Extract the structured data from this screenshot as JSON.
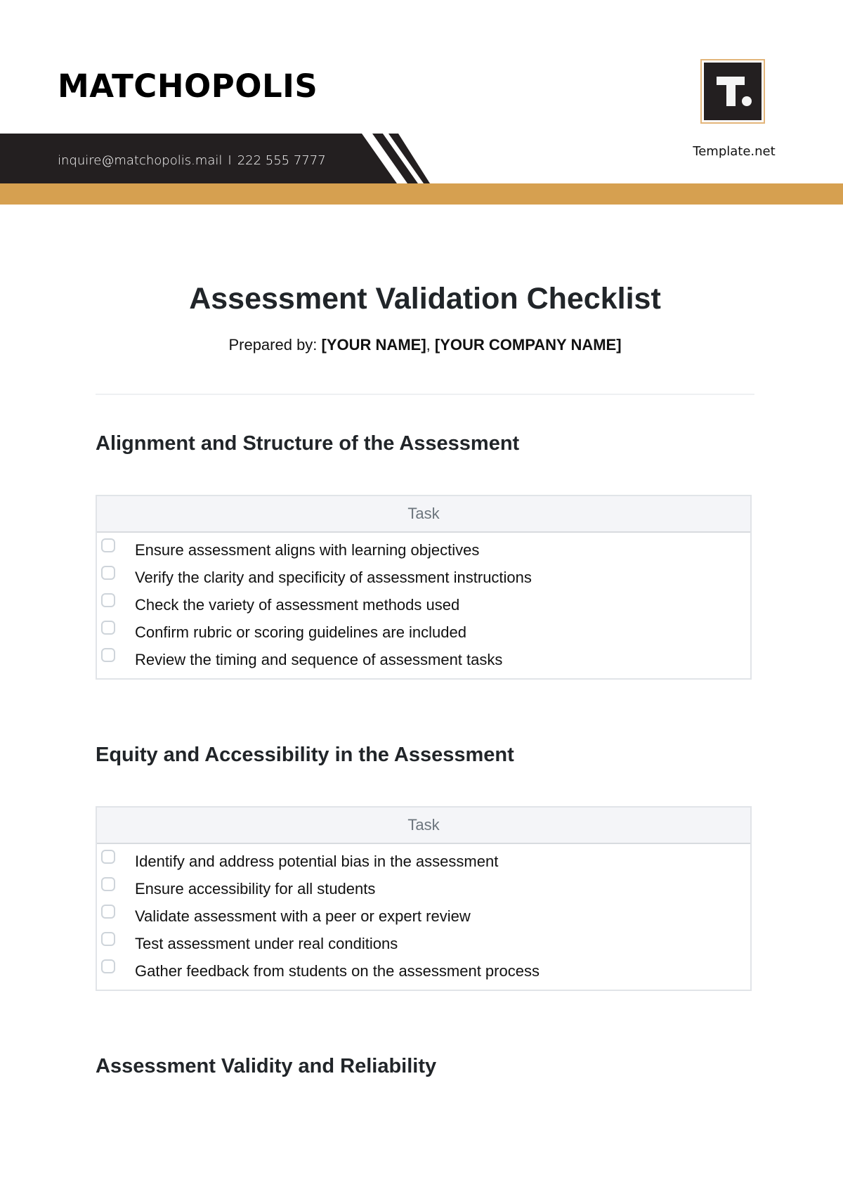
{
  "header": {
    "brand": "MATCHOPOLIS",
    "email": "inquire@matchopolis.mail",
    "separator": "I",
    "phone": "222 555 7777",
    "logo_icon": "template-net-logo-icon",
    "logo_caption": "Template.net",
    "colors": {
      "dark": "#231F20",
      "gold": "#D6A050",
      "logo_border": "#E3B57A"
    }
  },
  "document": {
    "title": "Assessment Validation Checklist",
    "prepared_label": "Prepared by:",
    "prepared_name": "[YOUR NAME]",
    "prepared_comma": ",",
    "prepared_company": "[YOUR COMPANY NAME]"
  },
  "sections": [
    {
      "title": "Alignment and Structure of the Assessment",
      "column_header": "Task",
      "tasks": [
        {
          "label": "Ensure assessment aligns with learning objectives",
          "checked": false
        },
        {
          "label": "Verify the clarity and specificity of assessment instructions",
          "checked": false
        },
        {
          "label": "Check the variety of assessment methods used",
          "checked": false
        },
        {
          "label": "Confirm rubric or scoring guidelines are included",
          "checked": false
        },
        {
          "label": "Review the timing and sequence of assessment tasks",
          "checked": false
        }
      ]
    },
    {
      "title": "Equity and Accessibility in the Assessment",
      "column_header": "Task",
      "tasks": [
        {
          "label": "Identify and address potential bias in the assessment",
          "checked": false
        },
        {
          "label": "Ensure accessibility for all students",
          "checked": false
        },
        {
          "label": "Validate assessment with a peer or expert review",
          "checked": false
        },
        {
          "label": "Test assessment under real conditions",
          "checked": false
        },
        {
          "label": "Gather feedback from students on the assessment process",
          "checked": false
        }
      ]
    },
    {
      "title": "Assessment Validity and Reliability"
    }
  ]
}
